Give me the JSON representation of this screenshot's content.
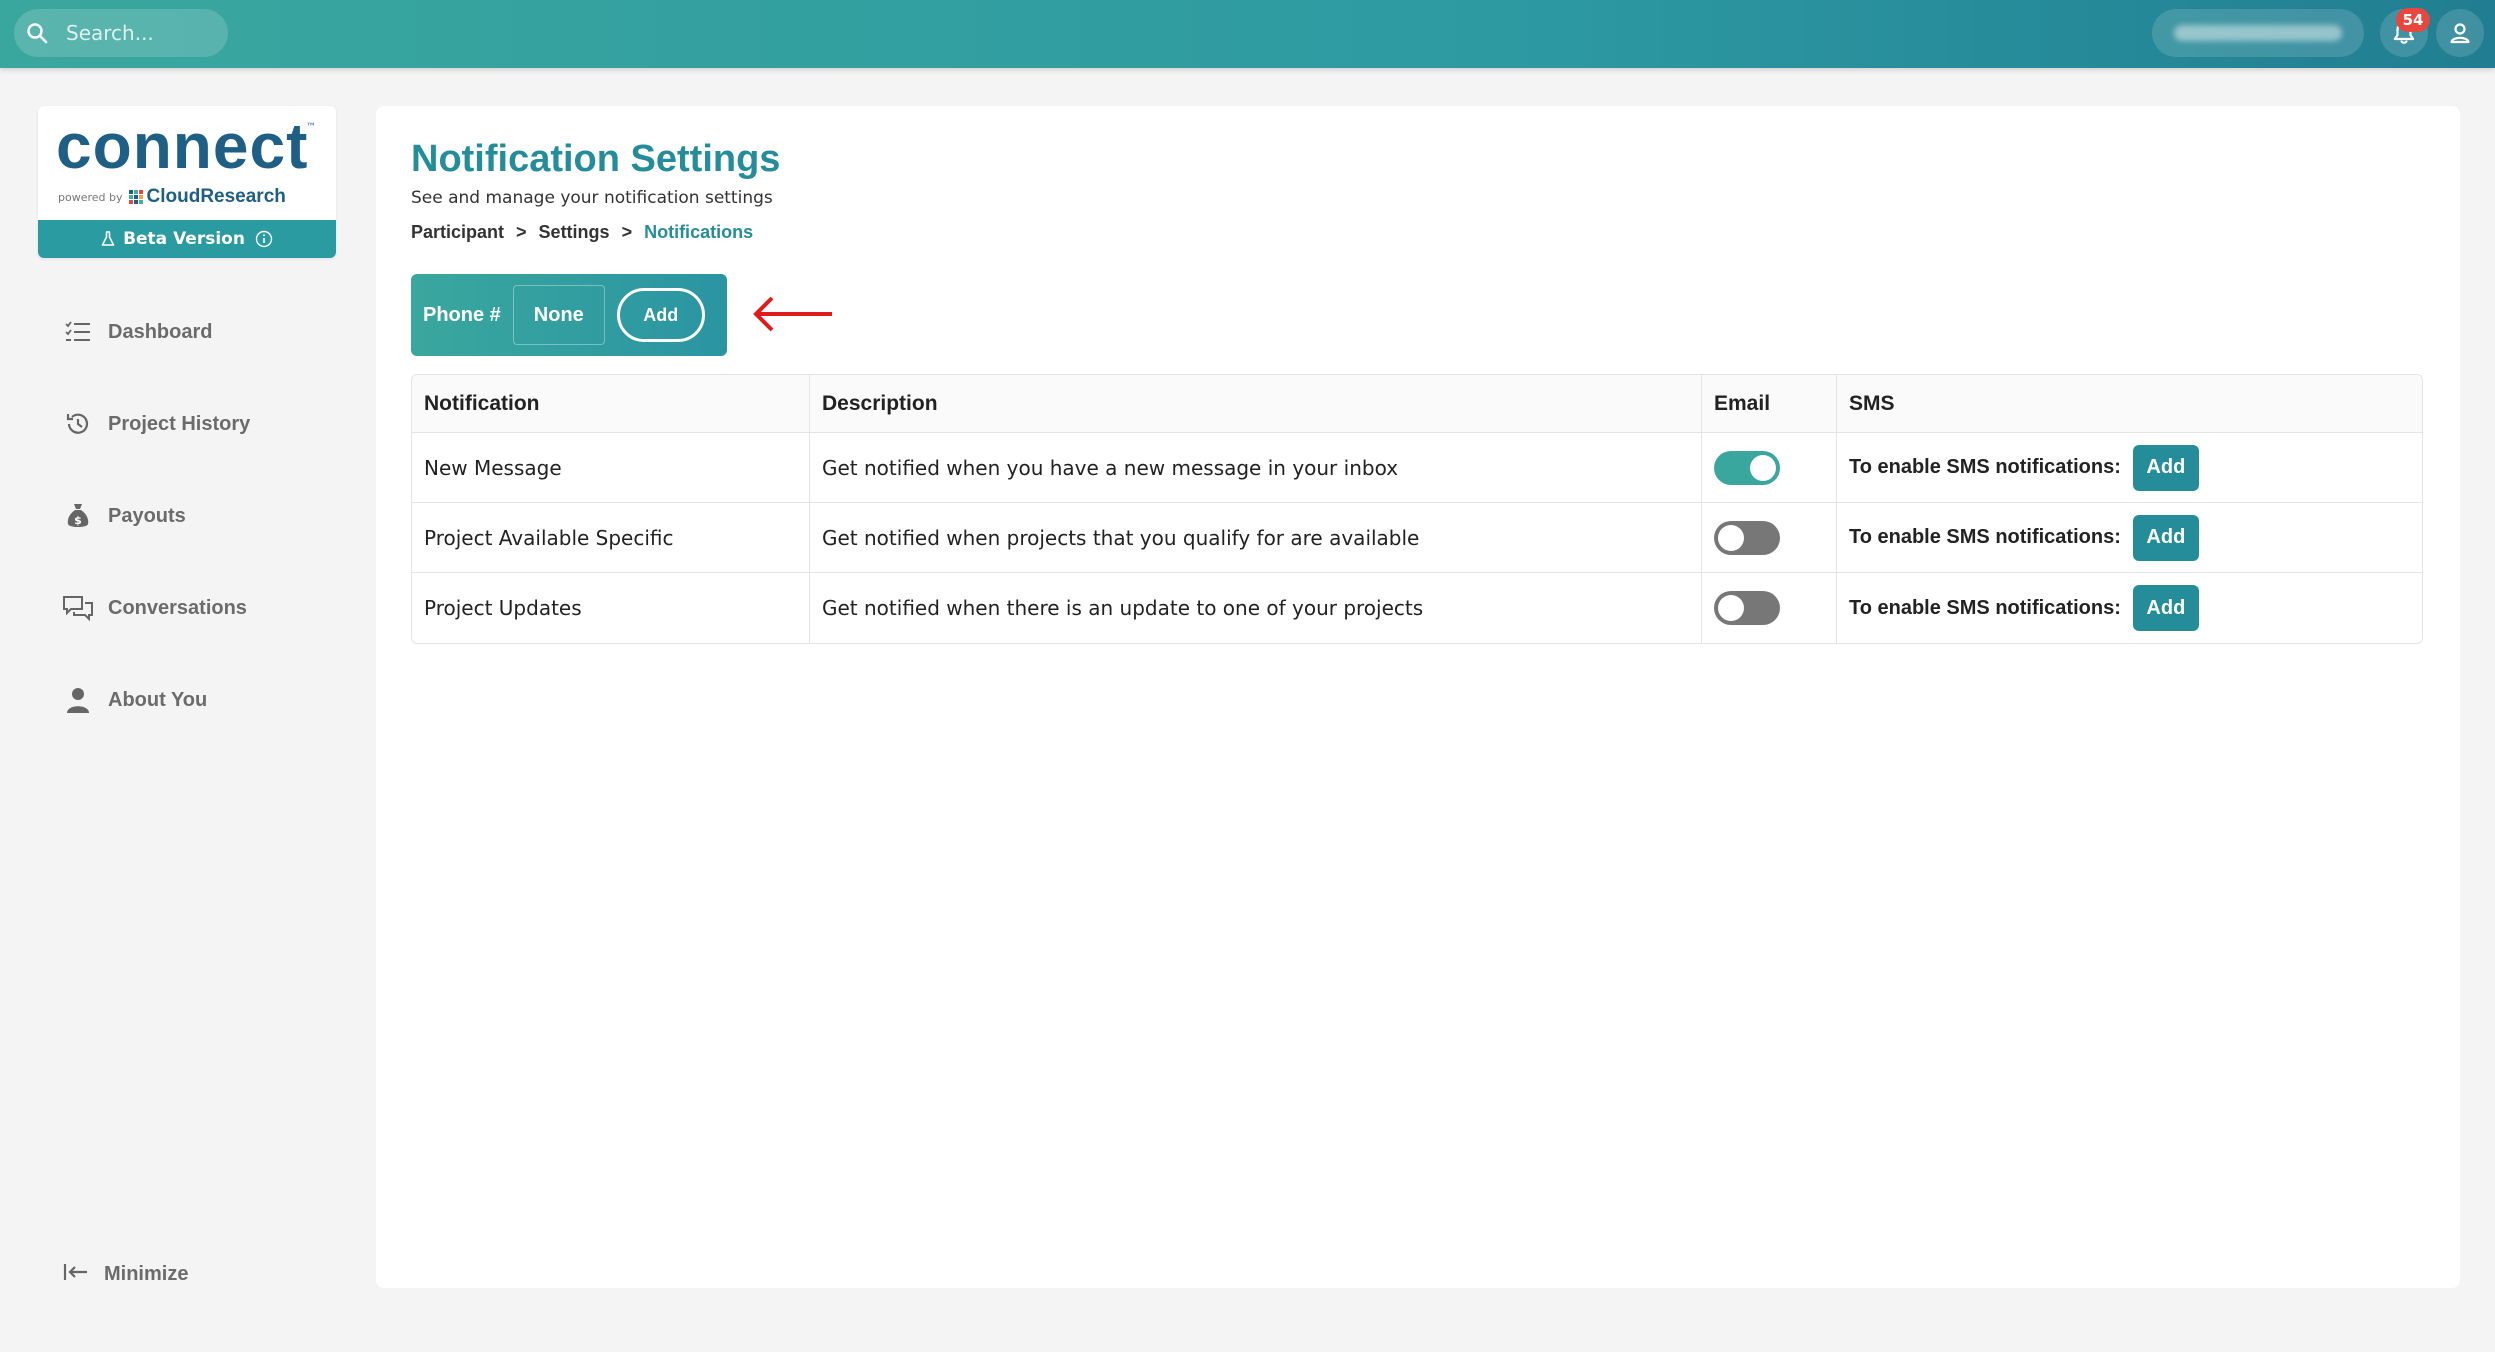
{
  "topbar": {
    "search_placeholder": "Search...",
    "notification_count": "54",
    "icons": [
      "search-icon",
      "bell-icon",
      "user-icon"
    ]
  },
  "sidebar": {
    "logo": {
      "word_part1": "co",
      "word_part2": "nnect",
      "tm": "™",
      "powered_by": "powered by",
      "brand": "CloudResearch"
    },
    "beta_label": "Beta Version",
    "items": [
      {
        "label": "Dashboard",
        "icon": "list-check-icon"
      },
      {
        "label": "Project History",
        "icon": "history-icon"
      },
      {
        "label": "Payouts",
        "icon": "money-bag-icon"
      },
      {
        "label": "Conversations",
        "icon": "chat-icon"
      },
      {
        "label": "About You",
        "icon": "person-icon"
      }
    ],
    "minimize_label": "Minimize"
  },
  "main": {
    "title": "Notification Settings",
    "subtitle": "See and manage your notification settings",
    "breadcrumb": [
      "Participant",
      "Settings",
      "Notifications"
    ],
    "breadcrumb_sep": ">",
    "phone": {
      "label": "Phone #",
      "value": "None",
      "add_label": "Add"
    },
    "table": {
      "headers": [
        "Notification",
        "Description",
        "Email",
        "SMS"
      ],
      "rows": [
        {
          "notification": "New Message",
          "description": "Get notified when you have a new message in your inbox",
          "email_enabled": true,
          "sms_text": "To enable SMS notifications:",
          "sms_add": "Add"
        },
        {
          "notification": "Project Available Specific",
          "description": "Get notified when projects that you qualify for are available",
          "email_enabled": false,
          "sms_text": "To enable SMS notifications:",
          "sms_add": "Add"
        },
        {
          "notification": "Project Updates",
          "description": "Get notified when there is an update to one of your projects",
          "email_enabled": false,
          "sms_text": "To enable SMS notifications:",
          "sms_add": "Add"
        }
      ]
    }
  },
  "colors": {
    "accent": "#248d99",
    "topbar_start": "#3aa79e",
    "topbar_end": "#217e92",
    "badge": "#e8473f",
    "annotation_arrow": "#e01b1b"
  }
}
